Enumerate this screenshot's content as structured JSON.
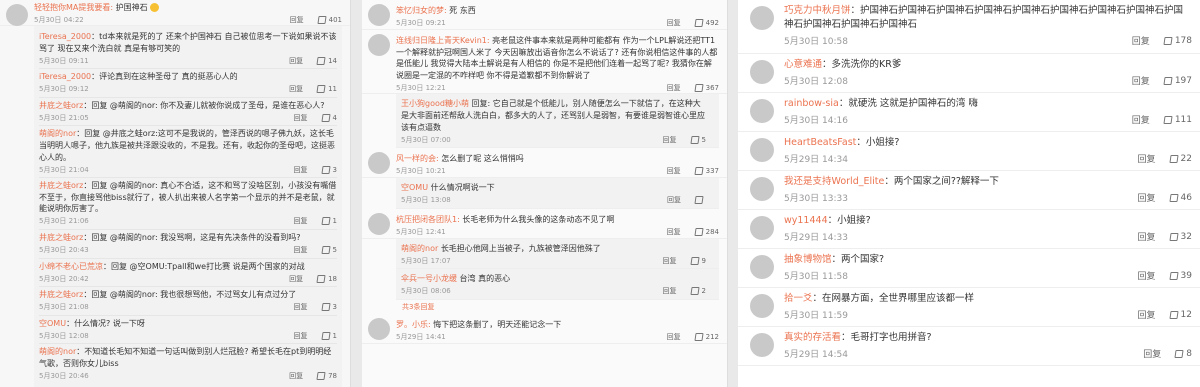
{
  "panel1": {
    "header": {
      "user": "轻轻抱你MA提我要看:",
      "text": "护国神石",
      "time": "5月30日 04:22",
      "reply": "回复",
      "likes": "401"
    },
    "replies": [
      {
        "user": "iTeresa_2000",
        "text": "td本来就是死的了 还来个护国神石 自己被位思考一下说如果说不该骂了 现在又来个洗白就 真是有够可笑的",
        "time": "5月30日 09:11",
        "reply": "回复",
        "likes": "14"
      },
      {
        "user": "iTeresa_2000",
        "text": "评论真到在这种圣母了 真的挺恶心人的",
        "time": "5月30日 09:12",
        "reply": "回复",
        "likes": "11"
      },
      {
        "user": "井底之蛙orz",
        "text": "回复 @萌阁的nor: 你不及妻儿就被你说成了圣母，是谁在恶心人?",
        "time": "5月30日 21:05",
        "reply": "回复",
        "likes": "4"
      },
      {
        "user": "萌阁的nor",
        "text": "回复 @井底之蛙orz:这可不是我说的，管泽西说的嗯子佛九妖，这长毛当明明人嗯子，他九族是被共泽跟没收的，不是我。还有，收起你的圣母吧，这挺恶心人的。",
        "time": "5月30日 21:04",
        "reply": "回复",
        "likes": "3"
      },
      {
        "user": "井底之蛙orz",
        "text": "回复 @萌阁的nor: 真心不合适，这不和骂了没啥区别，小孩没有嘴借不至于，你直接骂他biss就行了，被人扒出来被人名字第一个显示的并不是老鼠，就能说明你厉害了。",
        "time": "5月30日 21:06",
        "reply": "回复",
        "likes": "1"
      },
      {
        "user": "井底之蛙orz",
        "text": "回复 @萌阁的nor: 我没骂啊，这是有先决条件的没看到吗?",
        "time": "5月30日 20:43",
        "reply": "回复",
        "likes": "5"
      },
      {
        "user": "小绵不老心已荒凉",
        "text": "回复 @空OMU:Tpall和we打比赛 说是两个国家的对战",
        "time": "5月30日 20:42",
        "reply": "回复",
        "likes": "18"
      },
      {
        "user": "井底之蛙orz",
        "text": "回复 @萌阁的nor: 我也很想骂他，不过骂女儿有点过分了",
        "time": "5月30日 21:08",
        "reply": "回复",
        "likes": "3"
      },
      {
        "user": "空OMU",
        "text": "什么情况? 说一下呀",
        "time": "5月30日 12:08",
        "reply": "回复",
        "likes": "1"
      },
      {
        "user": "萌阁的nor",
        "text": "不知道长毛知不知道一句话叫做到别人烂冠脸? 希望长毛在pt到明明经气歌，否则你女儿biss",
        "time": "5月30日 20:46",
        "reply": "回复",
        "likes": "78"
      }
    ]
  },
  "panel2": {
    "comments": [
      {
        "user": "笨忆归女的梦:",
        "text": "死 东西",
        "time": "5月30日 09:21",
        "reply": "回复",
        "likes": "492"
      },
      {
        "user": "连线归日隆上青天Kevin1:",
        "text": "亮老鼠这件事本来就是两种可能都有 作为一个LPL解说还把TT1一个解释就护冠啊国人米了 今天因嘛放出语音你怎么不说话了? 还有你说相信这件事的人都是低能儿 我觉得大陆本土解说是有人相信的 你是不是把他们连着一起骂了呢? 我猜你在解说圈是一定混的不咋样吧 你不得是道歉都不到你解说了",
        "time": "5月30日 12:21",
        "reply": "回复",
        "likes": "367"
      },
      {
        "user": "王小狗good糖小萌",
        "text": "回复: 它自己就是个低能儿，别人随便怎么一下就信了，在这种大是大非面前还帮敌人洗白白，都多大的人了，还骂别人是弱智，有要谁是弱智谁心里应该有点逼数",
        "time": "5月30日 07:00",
        "reply": "回复",
        "likes": "5"
      },
      {
        "user": "风一样的会:",
        "text": "怎么删了呢 这么悄悄吗",
        "time": "5月30日 10:21",
        "reply": "回复",
        "likes": "337"
      },
      {
        "user": "空OMU",
        "text": "什么情况啊说一下",
        "time": "5月30日 13:08",
        "reply": "回复",
        "likes": ""
      },
      {
        "user": "杭压把闭各团队1:",
        "text": "长毛老师为什么我头像的这条动态不见了啊",
        "time": "5月30日 12:41",
        "reply": "回复",
        "likes": "284"
      },
      {
        "user": "萌阁的nor",
        "text": "长毛担心他网上当被子，九族被管泽因他殊了",
        "time": "5月30日 17:07",
        "reply": "回复",
        "likes": "9"
      },
      {
        "user": "伞兵一号小龙缓",
        "text": "台湾 真的恶心",
        "time": "5月30日 08:06",
        "reply": "回复",
        "likes": "2"
      },
      {
        "more": "共3条回复"
      },
      {
        "user": "罗。小乐:",
        "text": "悔下把这条删了，明天还能记念一下",
        "time": "5月29日 14:41",
        "reply": "回复",
        "likes": "212"
      }
    ]
  },
  "panel3": {
    "comments": [
      {
        "user": "巧克力中秋月饼",
        "text": "护国神石护国神石护国神石护国神石护国神石护国神石护国神石护国神石护国神石护国神石护国神石护国神石",
        "time": "5月30日 10:58",
        "reply": "回复",
        "likes": "178"
      },
      {
        "user": "心意难通",
        "text": "多洗洗你的KR爹",
        "time": "5月30日 12:08",
        "reply": "回复",
        "likes": "197"
      },
      {
        "user": "rainbow-sia",
        "text": "就硬洗 这就是护国神石的湾 嗨",
        "time": "5月30日 14:16",
        "reply": "回复",
        "likes": "111"
      },
      {
        "user": "HeartBeatsFast",
        "text": "小姐接?",
        "time": "5月29日 14:34",
        "reply": "回复",
        "likes": "22"
      },
      {
        "user": "我还是支持World_Elite",
        "text": "两个国家之间??解释一下",
        "time": "5月30日 13:33",
        "reply": "回复",
        "likes": "46"
      },
      {
        "user": "wy11444",
        "text": "小姐接?",
        "time": "5月29日 14:33",
        "reply": "回复",
        "likes": "32"
      },
      {
        "user": "抽象博物馆",
        "text": "两个国家?",
        "time": "5月30日 11:58",
        "reply": "回复",
        "likes": "39"
      },
      {
        "user": "拾一爻",
        "text": "在网暴方面，全世界哪里应该都一样",
        "time": "5月30日 11:59",
        "reply": "回复",
        "likes": "12"
      },
      {
        "user": "真实的存活看",
        "text": "毛哥打字也用拼音?",
        "time": "5月29日 14:54",
        "reply": "回复",
        "likes": "8"
      }
    ]
  }
}
